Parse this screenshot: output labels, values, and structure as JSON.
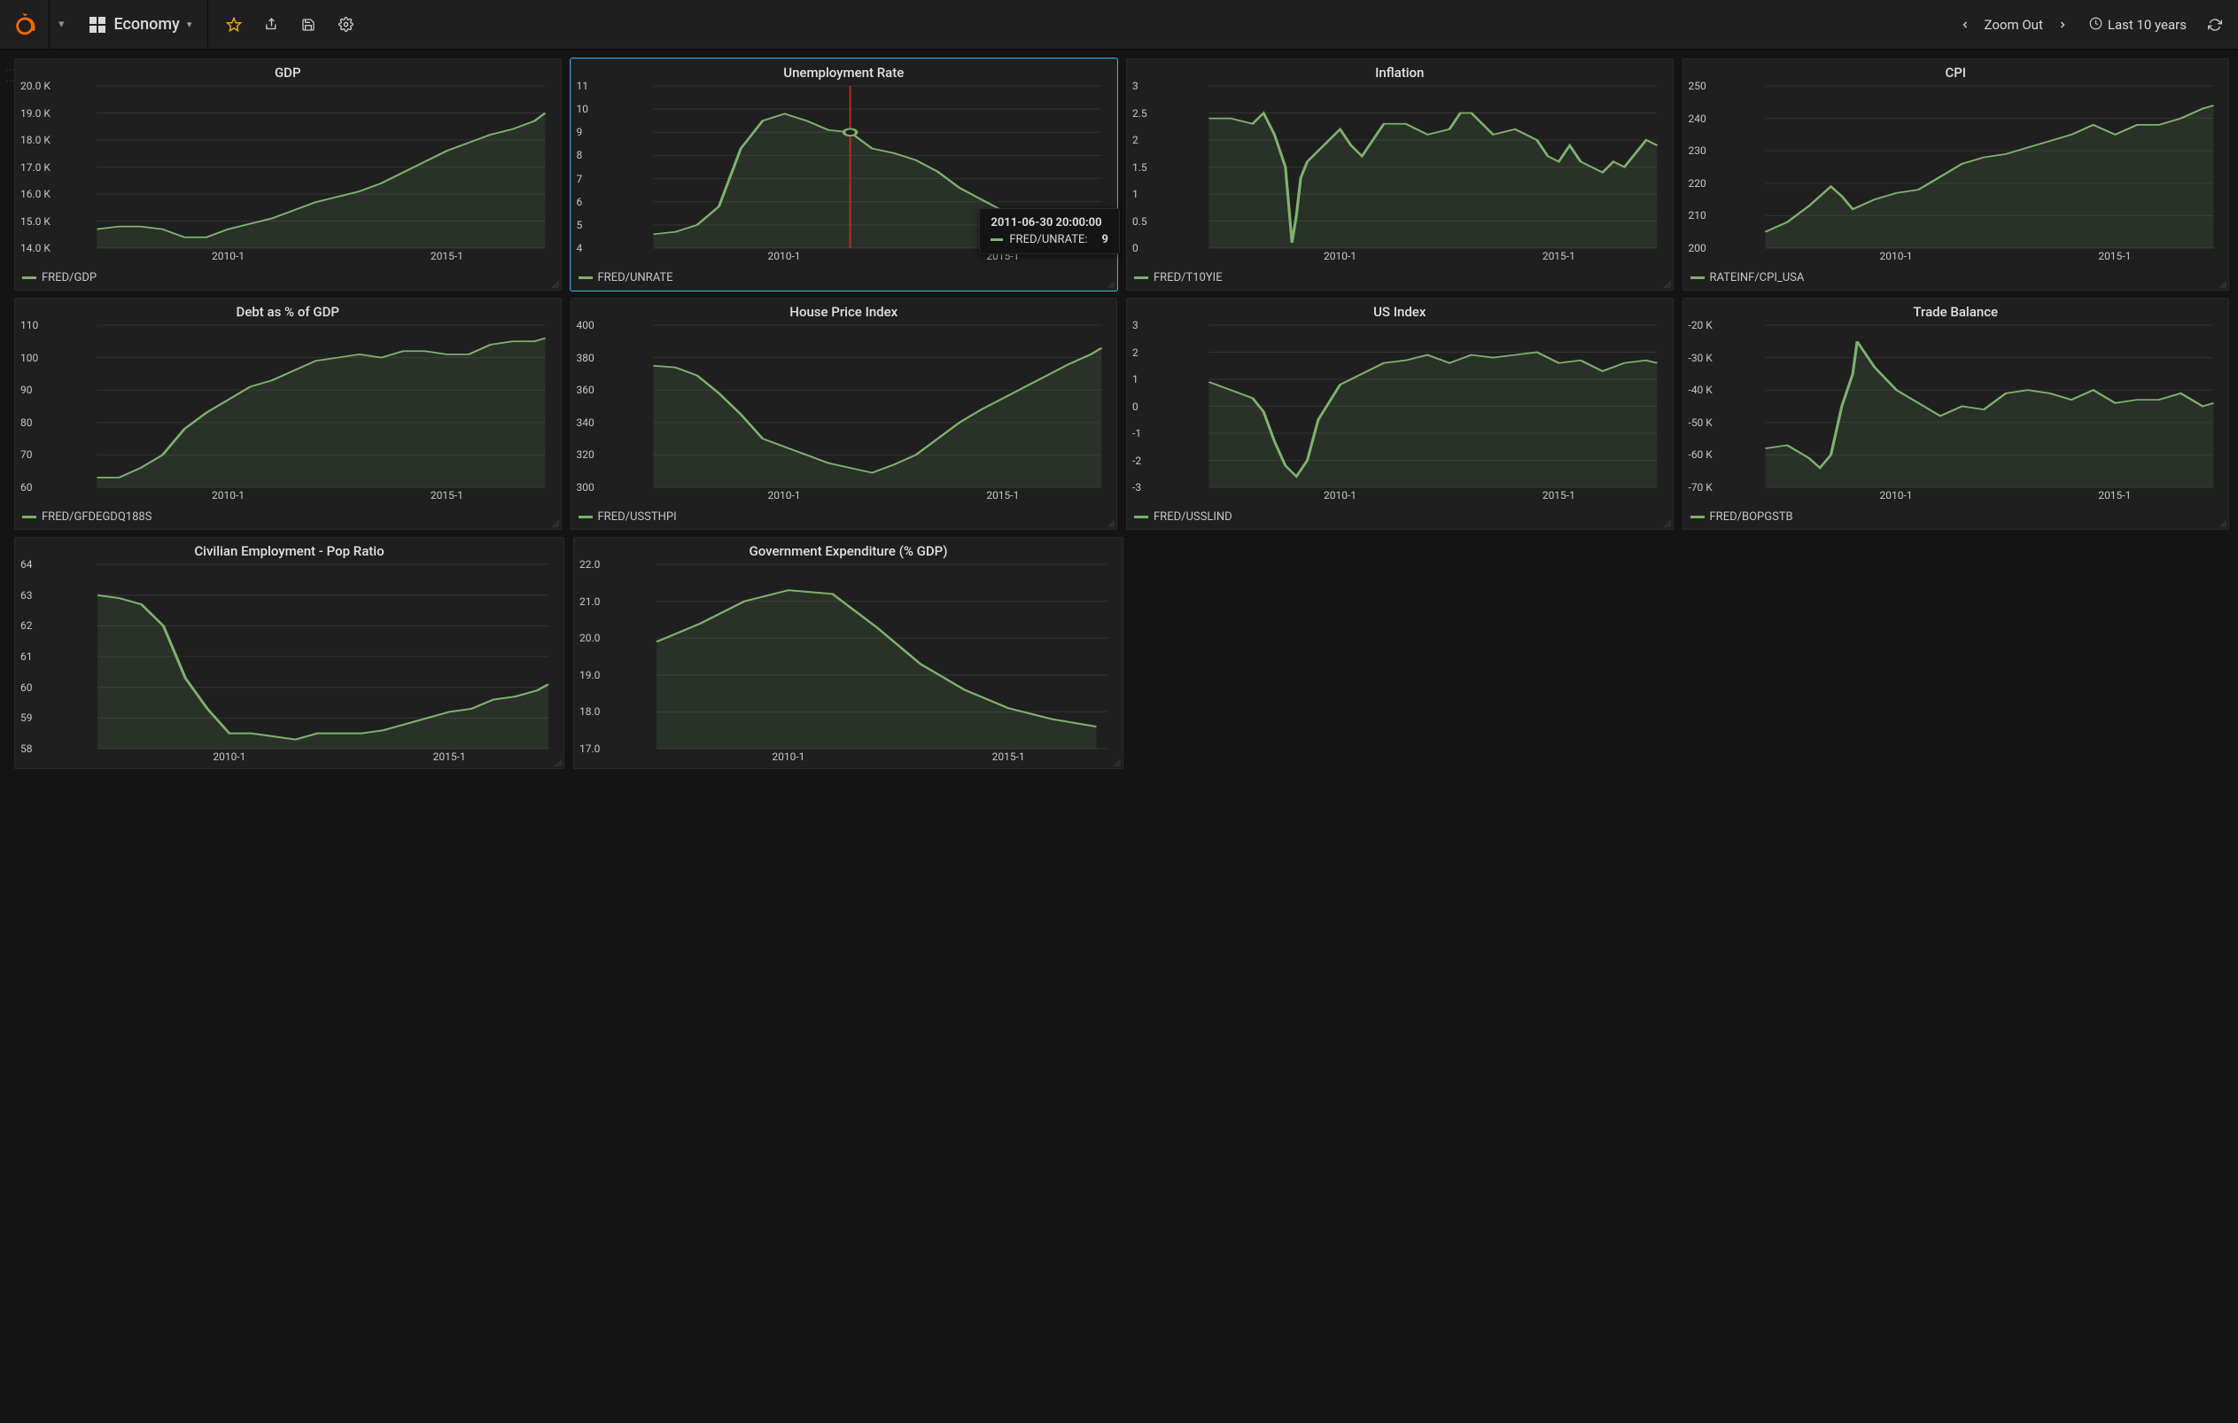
{
  "nav": {
    "dashboard_title": "Economy",
    "zoom_out_label": "Zoom Out",
    "time_range_label": "Last 10 years"
  },
  "tooltip": {
    "timestamp": "2011-06-30 20:00:00",
    "series_label": "FRED/UNRATE:",
    "value": "9"
  },
  "panels": [
    {
      "title": "GDP",
      "legend": "FRED/GDP",
      "key": "gdp",
      "ymin": 14000,
      "ymax": 20000,
      "yticks": [
        14000,
        15000,
        16000,
        17000,
        18000,
        19000,
        20000
      ],
      "ytickfmt": "k1",
      "xticks": [
        "2010-1",
        "2015-1"
      ]
    },
    {
      "title": "Unemployment Rate",
      "legend": "FRED/UNRATE",
      "key": "unrate",
      "ymin": 4,
      "ymax": 11,
      "yticks": [
        4,
        5,
        6,
        7,
        8,
        9,
        10,
        11
      ],
      "xticks": [
        "2010-1",
        "2015-1"
      ],
      "highlight": true
    },
    {
      "title": "Inflation",
      "legend": "FRED/T10YIE",
      "key": "inflation",
      "ymin": 0,
      "ymax": 3.0,
      "yticks": [
        0,
        0.5,
        1.0,
        1.5,
        2.0,
        2.5,
        3.0
      ],
      "xticks": [
        "2010-1",
        "2015-1"
      ]
    },
    {
      "title": "CPI",
      "legend": "RATEINF/CPI_USA",
      "key": "cpi",
      "ymin": 200,
      "ymax": 250,
      "yticks": [
        200,
        210,
        220,
        230,
        240,
        250
      ],
      "xticks": [
        "2010-1",
        "2015-1"
      ]
    },
    {
      "title": "Debt as % of GDP",
      "legend": "FRED/GFDEGDQ188S",
      "key": "debt",
      "ymin": 60,
      "ymax": 110,
      "yticks": [
        60,
        70,
        80,
        90,
        100,
        110
      ],
      "xticks": [
        "2010-1",
        "2015-1"
      ]
    },
    {
      "title": "House Price Index",
      "legend": "FRED/USSTHPI",
      "key": "hpi",
      "ymin": 300,
      "ymax": 400,
      "yticks": [
        300,
        320,
        340,
        360,
        380,
        400
      ],
      "xticks": [
        "2010-1",
        "2015-1"
      ]
    },
    {
      "title": "US Index",
      "legend": "FRED/USSLIND",
      "key": "usindex",
      "ymin": -3,
      "ymax": 3,
      "yticks": [
        -3,
        -2,
        -1,
        0,
        1,
        2,
        3
      ],
      "xticks": [
        "2010-1",
        "2015-1"
      ]
    },
    {
      "title": "Trade Balance",
      "legend": "FRED/BOPGSTB",
      "key": "trade",
      "ymin": -70000,
      "ymax": -20000,
      "yticks": [
        -70000,
        -60000,
        -50000,
        -40000,
        -30000,
        -20000
      ],
      "ytickfmt": "k0",
      "xticks": [
        "2010-1",
        "2015-1"
      ]
    },
    {
      "title": "Civilian Employment - Pop Ratio",
      "legend": "",
      "key": "emratio",
      "ymin": 58,
      "ymax": 64,
      "yticks": [
        58,
        59,
        60,
        61,
        62,
        63,
        64
      ],
      "xticks": [
        "2010-1",
        "2015-1"
      ]
    },
    {
      "title": "Government Expenditure (% GDP)",
      "legend": "",
      "key": "govexp",
      "ymin": 17.0,
      "ymax": 22.0,
      "yticks": [
        17.0,
        18.0,
        19.0,
        20.0,
        21.0,
        22.0
      ],
      "ytickfmt": "f1",
      "xticks": [
        "2010-1",
        "2015-1"
      ]
    }
  ],
  "chart_data": [
    {
      "key": "gdp",
      "title": "GDP",
      "type": "area",
      "x": [
        2007.0,
        2007.5,
        2008.0,
        2008.5,
        2009.0,
        2009.5,
        2010.0,
        2010.5,
        2011.0,
        2011.5,
        2012.0,
        2012.5,
        2013.0,
        2013.5,
        2014.0,
        2014.5,
        2015.0,
        2015.5,
        2016.0,
        2016.5,
        2017.0,
        2017.25
      ],
      "values": [
        14700,
        14800,
        14800,
        14700,
        14400,
        14400,
        14700,
        14900,
        15100,
        15400,
        15700,
        15900,
        16100,
        16400,
        16800,
        17200,
        17600,
        17900,
        18200,
        18400,
        18700,
        19000
      ],
      "series_name": "FRED/GDP",
      "ylim": [
        14000,
        20000
      ],
      "xlim": [
        2007,
        2017.25
      ],
      "xticklabels": [
        "2010-1",
        "2015-1"
      ]
    },
    {
      "key": "unrate",
      "title": "Unemployment Rate",
      "type": "area",
      "x": [
        2007.0,
        2007.5,
        2008.0,
        2008.5,
        2009.0,
        2009.5,
        2010.0,
        2010.5,
        2011.0,
        2011.5,
        2012.0,
        2012.5,
        2013.0,
        2013.5,
        2014.0,
        2014.5,
        2015.0,
        2015.5,
        2016.0,
        2016.5,
        2017.0,
        2017.25
      ],
      "values": [
        4.6,
        4.7,
        5.0,
        5.8,
        8.3,
        9.5,
        9.8,
        9.5,
        9.1,
        9.0,
        8.3,
        8.1,
        7.8,
        7.3,
        6.6,
        6.1,
        5.6,
        5.2,
        4.9,
        4.9,
        4.7,
        4.5
      ],
      "series_name": "FRED/UNRATE",
      "ylim": [
        4,
        11
      ],
      "xlim": [
        2007,
        2017.25
      ],
      "xticklabels": [
        "2010-1",
        "2015-1"
      ],
      "hover": {
        "x": 2011.5,
        "y": 9,
        "timestamp": "2011-06-30 20:00:00"
      }
    },
    {
      "key": "inflation",
      "title": "Inflation",
      "type": "area",
      "x": [
        2007.0,
        2007.5,
        2008.0,
        2008.25,
        2008.5,
        2008.75,
        2008.9,
        2009.0,
        2009.1,
        2009.25,
        2009.5,
        2010.0,
        2010.25,
        2010.5,
        2010.75,
        2011.0,
        2011.5,
        2012.0,
        2012.5,
        2012.75,
        2013.0,
        2013.5,
        2014.0,
        2014.5,
        2014.75,
        2015.0,
        2015.25,
        2015.5,
        2016.0,
        2016.25,
        2016.5,
        2017.0,
        2017.25
      ],
      "values": [
        2.4,
        2.4,
        2.3,
        2.5,
        2.1,
        1.5,
        0.1,
        0.6,
        1.3,
        1.6,
        1.8,
        2.2,
        1.9,
        1.7,
        2.0,
        2.3,
        2.3,
        2.1,
        2.2,
        2.5,
        2.5,
        2.1,
        2.2,
        2.0,
        1.7,
        1.6,
        1.9,
        1.6,
        1.4,
        1.6,
        1.5,
        2.0,
        1.9
      ],
      "series_name": "FRED/T10YIE",
      "ylim": [
        0,
        3.0
      ],
      "xlim": [
        2007,
        2017.25
      ],
      "xticklabels": [
        "2010-1",
        "2015-1"
      ]
    },
    {
      "key": "cpi",
      "title": "CPI",
      "type": "area",
      "x": [
        2007.0,
        2007.5,
        2008.0,
        2008.5,
        2008.75,
        2009.0,
        2009.5,
        2010.0,
        2010.5,
        2011.0,
        2011.5,
        2012.0,
        2012.5,
        2013.0,
        2013.5,
        2014.0,
        2014.5,
        2015.0,
        2015.5,
        2016.0,
        2016.5,
        2017.0,
        2017.25
      ],
      "values": [
        205,
        208,
        213,
        219,
        216,
        212,
        215,
        217,
        218,
        222,
        226,
        228,
        229,
        231,
        233,
        235,
        238,
        235,
        238,
        238,
        240,
        243,
        244
      ],
      "series_name": "RATEINF/CPI_USA",
      "ylim": [
        200,
        250
      ],
      "xlim": [
        2007,
        2017.25
      ],
      "xticklabels": [
        "2010-1",
        "2015-1"
      ]
    },
    {
      "key": "debt",
      "title": "Debt as % of GDP",
      "type": "area",
      "x": [
        2007.0,
        2007.5,
        2008.0,
        2008.5,
        2009.0,
        2009.5,
        2010.0,
        2010.5,
        2011.0,
        2011.5,
        2012.0,
        2012.5,
        2013.0,
        2013.5,
        2014.0,
        2014.5,
        2015.0,
        2015.5,
        2016.0,
        2016.5,
        2017.0,
        2017.25
      ],
      "values": [
        63,
        63,
        66,
        70,
        78,
        83,
        87,
        91,
        93,
        96,
        99,
        100,
        101,
        100,
        102,
        102,
        101,
        101,
        104,
        105,
        105,
        106
      ],
      "series_name": "FRED/GFDEGDQ188S",
      "ylim": [
        60,
        110
      ],
      "xlim": [
        2007,
        2017.25
      ],
      "xticklabels": [
        "2010-1",
        "2015-1"
      ]
    },
    {
      "key": "hpi",
      "title": "House Price Index",
      "type": "area",
      "x": [
        2007.0,
        2007.5,
        2008.0,
        2008.5,
        2009.0,
        2009.5,
        2010.0,
        2010.5,
        2011.0,
        2011.5,
        2012.0,
        2012.5,
        2013.0,
        2013.5,
        2014.0,
        2014.5,
        2015.0,
        2015.5,
        2016.0,
        2016.5,
        2017.0,
        2017.25
      ],
      "values": [
        375,
        374,
        369,
        358,
        345,
        330,
        325,
        320,
        315,
        312,
        309,
        314,
        320,
        330,
        340,
        348,
        355,
        362,
        369,
        376,
        382,
        386
      ],
      "series_name": "FRED/USSTHPI",
      "ylim": [
        300,
        400
      ],
      "xlim": [
        2007,
        2017.25
      ],
      "xticklabels": [
        "2010-1",
        "2015-1"
      ]
    },
    {
      "key": "usindex",
      "title": "US Index",
      "type": "area",
      "x": [
        2007.0,
        2007.5,
        2008.0,
        2008.25,
        2008.5,
        2008.75,
        2009.0,
        2009.25,
        2009.5,
        2010.0,
        2010.5,
        2011.0,
        2011.5,
        2012.0,
        2012.5,
        2013.0,
        2013.5,
        2014.0,
        2014.5,
        2015.0,
        2015.5,
        2016.0,
        2016.5,
        2017.0,
        2017.25
      ],
      "values": [
        0.9,
        0.6,
        0.3,
        -0.2,
        -1.3,
        -2.2,
        -2.6,
        -2.0,
        -0.5,
        0.8,
        1.2,
        1.6,
        1.7,
        1.9,
        1.6,
        1.9,
        1.8,
        1.9,
        2.0,
        1.6,
        1.7,
        1.3,
        1.6,
        1.7,
        1.6
      ],
      "series_name": "FRED/USSLIND",
      "ylim": [
        -3,
        3
      ],
      "xlim": [
        2007,
        2017.25
      ],
      "xticklabels": [
        "2010-1",
        "2015-1"
      ]
    },
    {
      "key": "trade",
      "title": "Trade Balance",
      "type": "area",
      "x": [
        2007.0,
        2007.5,
        2008.0,
        2008.25,
        2008.5,
        2008.75,
        2009.0,
        2009.1,
        2009.25,
        2009.5,
        2010.0,
        2010.5,
        2011.0,
        2011.5,
        2012.0,
        2012.5,
        2013.0,
        2013.5,
        2014.0,
        2014.5,
        2015.0,
        2015.5,
        2016.0,
        2016.5,
        2017.0,
        2017.25
      ],
      "values": [
        -58000,
        -57000,
        -61000,
        -64000,
        -60000,
        -45000,
        -35000,
        -25000,
        -28000,
        -33000,
        -40000,
        -44000,
        -48000,
        -45000,
        -46000,
        -41000,
        -40000,
        -41000,
        -43000,
        -40000,
        -44000,
        -43000,
        -43000,
        -41000,
        -45000,
        -44000
      ],
      "series_name": "FRED/BOPGSTB",
      "ylim": [
        -70000,
        -20000
      ],
      "xlim": [
        2007,
        2017.25
      ],
      "xticklabels": [
        "2010-1",
        "2015-1"
      ]
    },
    {
      "key": "emratio",
      "title": "Civilian Employment - Pop Ratio",
      "type": "area",
      "x": [
        2007.0,
        2007.5,
        2008.0,
        2008.5,
        2009.0,
        2009.5,
        2010.0,
        2010.5,
        2011.0,
        2011.5,
        2012.0,
        2012.5,
        2013.0,
        2013.5,
        2014.0,
        2014.5,
        2015.0,
        2015.5,
        2016.0,
        2016.5,
        2017.0,
        2017.25
      ],
      "values": [
        63.0,
        62.9,
        62.7,
        62.0,
        60.3,
        59.3,
        58.5,
        58.5,
        58.4,
        58.3,
        58.5,
        58.5,
        58.5,
        58.6,
        58.8,
        59.0,
        59.2,
        59.3,
        59.6,
        59.7,
        59.9,
        60.1
      ],
      "series_name": "",
      "ylim": [
        58,
        64
      ],
      "xlim": [
        2007,
        2017.25
      ],
      "xticklabels": [
        "2010-1",
        "2015-1"
      ]
    },
    {
      "key": "govexp",
      "title": "Government Expenditure (% GDP)",
      "type": "area",
      "x": [
        2007.0,
        2008.0,
        2009.0,
        2010.0,
        2011.0,
        2012.0,
        2013.0,
        2014.0,
        2015.0,
        2016.0,
        2017.0
      ],
      "values": [
        19.9,
        20.4,
        21.0,
        21.3,
        21.2,
        20.3,
        19.3,
        18.6,
        18.1,
        17.8,
        17.6
      ],
      "series_name": "",
      "ylim": [
        17.0,
        22.0
      ],
      "xlim": [
        2007,
        2017.25
      ],
      "xticklabels": [
        "2010-1",
        "2015-1"
      ]
    }
  ]
}
